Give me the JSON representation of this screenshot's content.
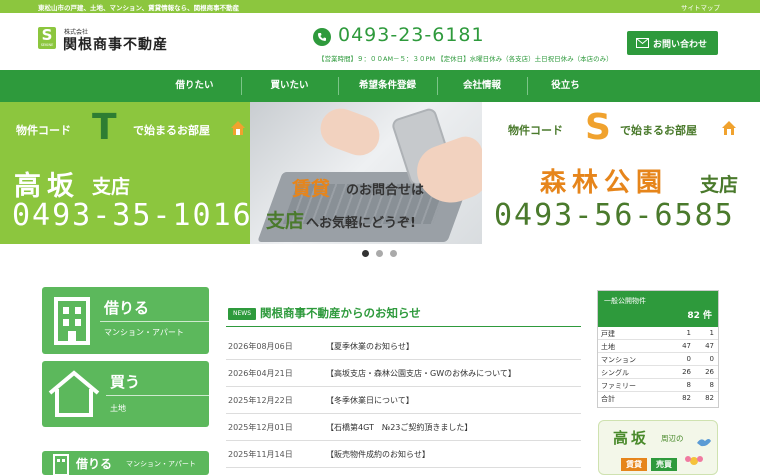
{
  "topbar": {
    "tagline": "東松山市の戸建、土地、マンション、賃貸情報なら、関根商事不動産",
    "sitemap": "サイトマップ"
  },
  "header": {
    "logo_mark": "S",
    "logo_mark_sub": "SEKINE",
    "logo_small": "株式会社",
    "logo_name": "関根商事不動産",
    "phone": "0493-23-6181",
    "hours": "【営業時間】９：００AM－５：３０PM 【定休日】水曜日休み（各支店）土日祝日休み（本店のみ）",
    "contact_label": "お問い合わせ"
  },
  "nav": {
    "items": [
      "借りたい",
      "買いたい",
      "希望条件登録",
      "会社情報",
      "役立ち"
    ]
  },
  "hero": {
    "left_code_pre": "物件コード",
    "left_letter": "T",
    "left_code_post": "で始まるお部屋",
    "left_branch": "高坂",
    "left_branch_suffix": "支店",
    "left_phone": "0493-35-1016",
    "center_1": "賃貸",
    "center_1b": "のお問合せは",
    "center_2": "支店",
    "center_2b": "へお気軽にどうぞ!",
    "right_code_pre": "物件コード",
    "right_letter": "S",
    "right_code_post": "で始まるお部屋",
    "right_branch": "森林公園",
    "right_branch_suffix": "支店",
    "right_phone": "0493-56-6585"
  },
  "cards": [
    {
      "title": "借りる",
      "sub": "マンション・アパート"
    },
    {
      "title": "買う",
      "sub": "土地"
    },
    {
      "title": "借りる",
      "sub": "マンション・アパート"
    }
  ],
  "news": {
    "badge": "NEWS",
    "title": "関根商事不動産からのお知らせ",
    "items": [
      {
        "date": "2026年08月06日",
        "text": "【夏季休業のお知らせ】"
      },
      {
        "date": "2026年04月21日",
        "text": "【高坂支店・森林公園支店・GWのお休みについて】"
      },
      {
        "date": "2025年12月22日",
        "text": "【冬季休業日について】"
      },
      {
        "date": "2025年12月01日",
        "text": "【石橋第4GT　№23ご契約頂きました】"
      },
      {
        "date": "2025年11月14日",
        "text": "【販売物件成約のお知らせ】"
      }
    ]
  },
  "stats": {
    "label": "一般公開物件",
    "total": "82 件",
    "rows": [
      {
        "k": "戸建",
        "v1": "1",
        "v2": "1"
      },
      {
        "k": "土地",
        "v1": "47",
        "v2": "47"
      },
      {
        "k": "マンション",
        "v1": "0",
        "v2": "0"
      },
      {
        "k": "シングル",
        "v1": "26",
        "v2": "26"
      },
      {
        "k": "ファミリー",
        "v1": "8",
        "v2": "8"
      },
      {
        "k": "合計",
        "v1": "82",
        "v2": "82"
      }
    ]
  },
  "banner": {
    "branch": "高坂",
    "suffix": "周辺の",
    "tag1": "賃貸",
    "tag2": "売買"
  },
  "colors": {
    "primary_green": "#2e9a3c",
    "light_green": "#8cc63e",
    "orange": "#e6851b"
  }
}
